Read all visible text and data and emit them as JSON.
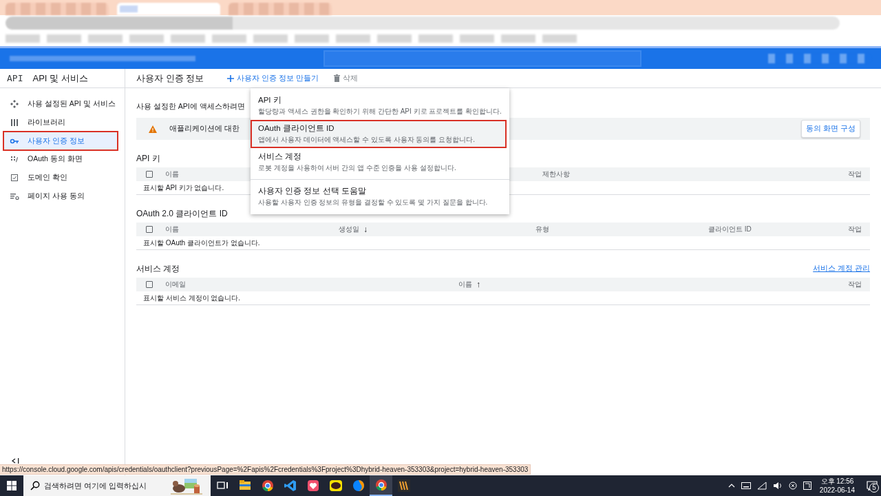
{
  "browser_tabs": [
    {
      "selected": false
    },
    {
      "selected": true
    },
    {
      "selected": false
    }
  ],
  "sidebar": {
    "logo": "API",
    "title": "API 및 서비스",
    "items": [
      {
        "label": "사용 설정된 API 및 서비스",
        "selected": false,
        "highlighted": false
      },
      {
        "label": "라이브러리",
        "selected": false,
        "highlighted": false
      },
      {
        "label": "사용자 인증 정보",
        "selected": true,
        "highlighted": true
      },
      {
        "label": "OAuth 동의 화면",
        "selected": false,
        "highlighted": false
      },
      {
        "label": "도메인 확인",
        "selected": false,
        "highlighted": false
      },
      {
        "label": "페이지 사용 동의",
        "selected": false,
        "highlighted": false
      }
    ]
  },
  "page": {
    "title": "사용자 인증 정보",
    "actions": [
      {
        "kind": "create",
        "label": "사용자 인증 정보 만들기",
        "disabled": false
      },
      {
        "kind": "delete",
        "label": "삭제",
        "disabled": true
      }
    ]
  },
  "create_menu": {
    "items": [
      {
        "title": "API 키",
        "description": "할당량과 액세스 권한을 확인하기 위해 간단한 API 키로 프로젝트를 확인합니다.",
        "highlighted": false,
        "divider_before": false
      },
      {
        "title": "OAuth 클라이언트 ID",
        "description": "앱에서 사용자 데이터에 액세스할 수 있도록 사용자 동의를 요청합니다.",
        "highlighted": true,
        "divider_before": false
      },
      {
        "title": "서비스 계정",
        "description": "로봇 계정을 사용하여 서버 간의 앱 수준 인증을 사용 설정합니다.",
        "highlighted": false,
        "divider_before": false
      },
      {
        "title": "사용자 인증 정보 선택 도움말",
        "description": "사용할 사용자 인증 정보의 유형을 결정할 수 있도록 몇 가지 질문을 합니다.",
        "highlighted": false,
        "divider_before": true
      }
    ]
  },
  "intro": "사용 설정한 API에 액세스하려면",
  "banner": {
    "text": "애플리케이션에 대한",
    "button": "동의 화면 구성"
  },
  "sections": [
    {
      "title": "API 키",
      "select_all_checked": false,
      "columns": [
        {
          "label": "이름"
        },
        {
          "label": "제한사항"
        },
        {
          "label": "작업"
        }
      ],
      "empty": "표시할 API 키가 없습니다."
    },
    {
      "title": "OAuth 2.0 클라이언트 ID",
      "select_all_checked": false,
      "columns": [
        {
          "label": "이름"
        },
        {
          "label": "생성일",
          "arrow": "↓"
        },
        {
          "label": "유형"
        },
        {
          "label": "클라이언트 ID"
        },
        {
          "label": "작업"
        }
      ],
      "empty": "표시할 OAuth 클라이언트가 없습니다."
    },
    {
      "title": "서비스 계정",
      "link": "서비스 계정 관리",
      "select_all_checked": false,
      "columns": [
        {
          "label": "이메일"
        },
        {
          "label": "이름",
          "arrow": "↑"
        },
        {
          "label": "작업"
        }
      ],
      "empty": "표시할 서비스 계정이 없습니다."
    }
  ],
  "status_url": "https://console.cloud.google.com/apis/credentials/oauthclient?previousPage=%2Fapis%2Fcredentials%3Fproject%3Dhybrid-heaven-353303&project=hybrid-heaven-353303",
  "taskbar": {
    "search_placeholder": "검색하려면 여기에 입력하십시",
    "apps": [
      {
        "kind": "taskview",
        "active": false
      },
      {
        "kind": "folder",
        "active": false
      },
      {
        "kind": "chrome",
        "active": false
      },
      {
        "kind": "vscode",
        "active": false
      },
      {
        "kind": "pink",
        "active": false
      },
      {
        "kind": "kakao",
        "active": false
      },
      {
        "kind": "firefox",
        "active": false
      },
      {
        "kind": "chrome",
        "active": true
      },
      {
        "kind": "stripes",
        "active": false
      }
    ],
    "time": "오후 12:56",
    "date": "2022-06-14",
    "notifications": "5"
  }
}
